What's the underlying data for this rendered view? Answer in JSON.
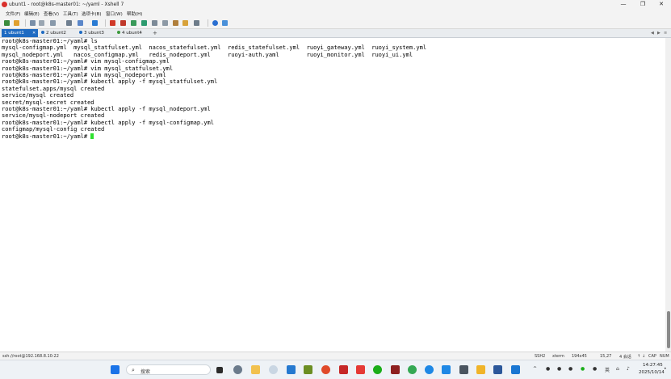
{
  "window": {
    "title": "ubunt1 - root@k8s-master01: ~/yaml - Xshell 7",
    "min_glyph": "—",
    "max_glyph": "❐",
    "close_glyph": "✕"
  },
  "menu": [
    "文件(F)",
    "编辑(E)",
    "查看(V)",
    "工具(T)",
    "选项卡(B)",
    "窗口(W)",
    "帮助(H)"
  ],
  "tabs": [
    {
      "label": "1 ubunt1",
      "active": true
    },
    {
      "label": "2 ubunt2",
      "active": false
    },
    {
      "label": "3 ubunt3",
      "active": false
    },
    {
      "label": "4 ubunt4",
      "active": false
    }
  ],
  "tab_add": "+",
  "terminal_lines": [
    "root@k8s-master01:~/yaml# ls",
    "mysql-configmap.yml  mysql_statfulset.yml  nacos_statefulset.yml  redis_statefulset.yml  ruoyi_gateway.yml  ruoyi_system.yml",
    "mysql_nodeport.yml   nacos_configmap.yml   redis_nodeport.yml     ruoyi-auth.yaml        ruoyi_monitor.yml  ruoyi_ui.yml",
    "root@k8s-master01:~/yaml# vim mysql-configmap.yml",
    "root@k8s-master01:~/yaml# vim mysql_statfulset.yml",
    "root@k8s-master01:~/yaml# vim mysql_nodeport.yml",
    "root@k8s-master01:~/yaml# kubectl apply -f mysql_statfulset.yml",
    "statefulset.apps/mysql created",
    "service/mysql created",
    "secret/mysql-secret created",
    "root@k8s-master01:~/yaml# kubectl apply -f mysql_nodeport.yml",
    "service/mysql-nodeport created",
    "root@k8s-master01:~/yaml# kubectl apply -f mysql-configmap.yml",
    "configmap/mysql-config created",
    "root@k8s-master01:~/yaml# "
  ],
  "status": {
    "connection": "ssh://root@192.168.8.10:22",
    "protocol": "SSH2",
    "term": "xterm",
    "size": "194x45",
    "position": "15,27",
    "sessions": "4 会话",
    "cap": "CAP",
    "num": "NUM"
  },
  "taskbar": {
    "search_placeholder": "搜索",
    "ime": "英",
    "time": "14:27:45",
    "date": "2025/10/14"
  },
  "colors": {
    "active_tab": "#1f6bc2",
    "cursor": "#2ee02e",
    "xshell_red": "#d9302c"
  }
}
